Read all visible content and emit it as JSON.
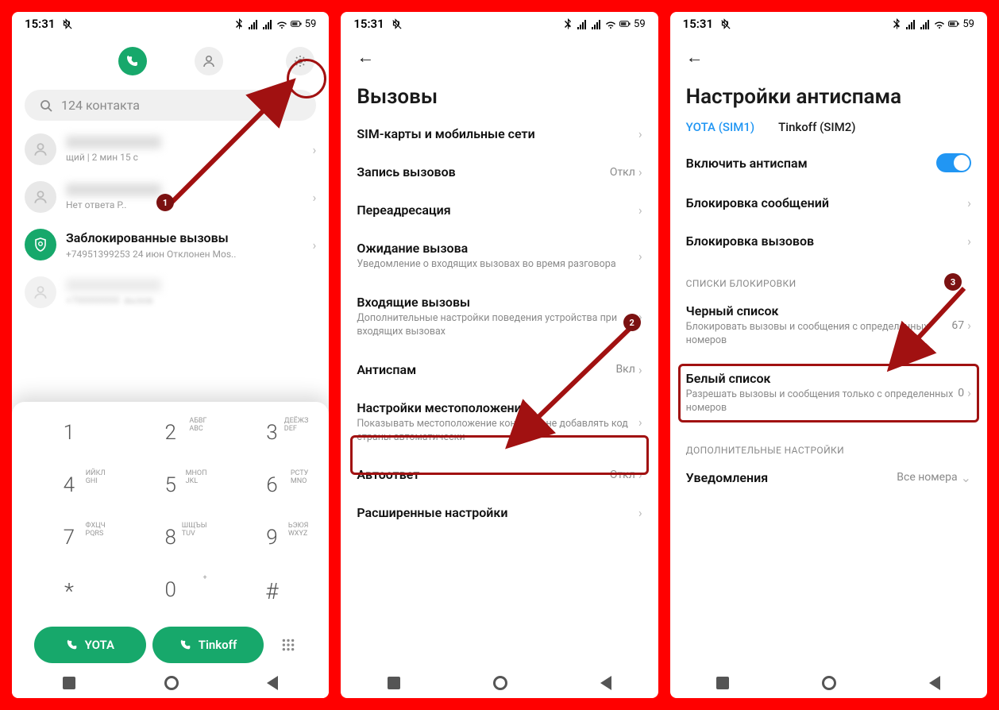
{
  "statusbar": {
    "time": "15:31",
    "battery": "59"
  },
  "screen1": {
    "search_placeholder": "124 контакта",
    "log": {
      "item1_sub": "щий | 2 мин 15 с",
      "item2_sub": "Нет ответа  Р..",
      "item3_title": "Заблокированные вызовы",
      "item3_sub": "+74951399253  24 июн Отклонен  Mos.."
    },
    "keys": [
      {
        "n": "1",
        "l": ""
      },
      {
        "n": "2",
        "l": "АБВГ\nABC"
      },
      {
        "n": "3",
        "l": "ДЕЁЖЗ\nDEF"
      },
      {
        "n": "4",
        "l": "ИЙКЛ\nGHI"
      },
      {
        "n": "5",
        "l": "МНОП\nJKL"
      },
      {
        "n": "6",
        "l": "РСТУ\nMNO"
      },
      {
        "n": "7",
        "l": "ФХЦЧ\nPQRS"
      },
      {
        "n": "8",
        "l": "ШЩЪЫ\nTUV"
      },
      {
        "n": "9",
        "l": "ЬЭЮЯ\nWXYZ"
      },
      {
        "n": "*",
        "l": ""
      },
      {
        "n": "0",
        "l": "+"
      },
      {
        "n": "#",
        "l": ""
      }
    ],
    "call1": "YOTA",
    "call2": "Tinkoff"
  },
  "screen2": {
    "title": "Вызовы",
    "items": [
      {
        "lbl": "SIM-карты и мобильные сети",
        "sub": "",
        "val": "",
        "chev": true
      },
      {
        "lbl": "Запись вызовов",
        "sub": "",
        "val": "Откл",
        "chev": true
      },
      {
        "lbl": "Переадресация",
        "sub": "",
        "val": "",
        "chev": true
      },
      {
        "lbl": "Ожидание вызова",
        "sub": "Уведомление о входящих вызовах во время разговора",
        "val": "",
        "chev": true
      },
      {
        "lbl": "Входящие вызовы",
        "sub": "Дополнительные настройки поведения устройства при входящих вызовах",
        "val": "",
        "chev": true
      },
      {
        "lbl": "Антиспам",
        "sub": "",
        "val": "Вкл",
        "chev": true
      },
      {
        "lbl": "Настройки местоположения",
        "sub": "Показывать местоположение контакта, не добавлять код страны автоматически",
        "val": "",
        "chev": true
      },
      {
        "lbl": "Автоответ",
        "sub": "",
        "val": "Откл",
        "chev": true
      },
      {
        "lbl": "Расширенные настройки",
        "sub": "",
        "val": "",
        "chev": true
      }
    ]
  },
  "screen3": {
    "title": "Настройки антиспама",
    "sim1": "YOTA (SIM1)",
    "sim2": "Tinkoff (SIM2)",
    "row_enable": "Включить антиспам",
    "row_block_msg": "Блокировка сообщений",
    "row_block_calls": "Блокировка вызовов",
    "hdr_blocklists": "СПИСКИ БЛОКИРОВКИ",
    "row_black": "Черный список",
    "row_black_sub": "Блокировать вызовы и сообщения с определенных номеров",
    "row_black_val": "67",
    "row_white": "Белый список",
    "row_white_sub": "Разрешать вызовы и сообщения только с определенных номеров",
    "row_white_val": "0",
    "hdr_extra": "ДОПОЛНИТЕЛЬНЫЕ НАСТРОЙКИ",
    "row_notif": "Уведомления",
    "row_notif_val": "Все номера"
  },
  "steps": {
    "s1": "1",
    "s2": "2",
    "s3": "3"
  }
}
